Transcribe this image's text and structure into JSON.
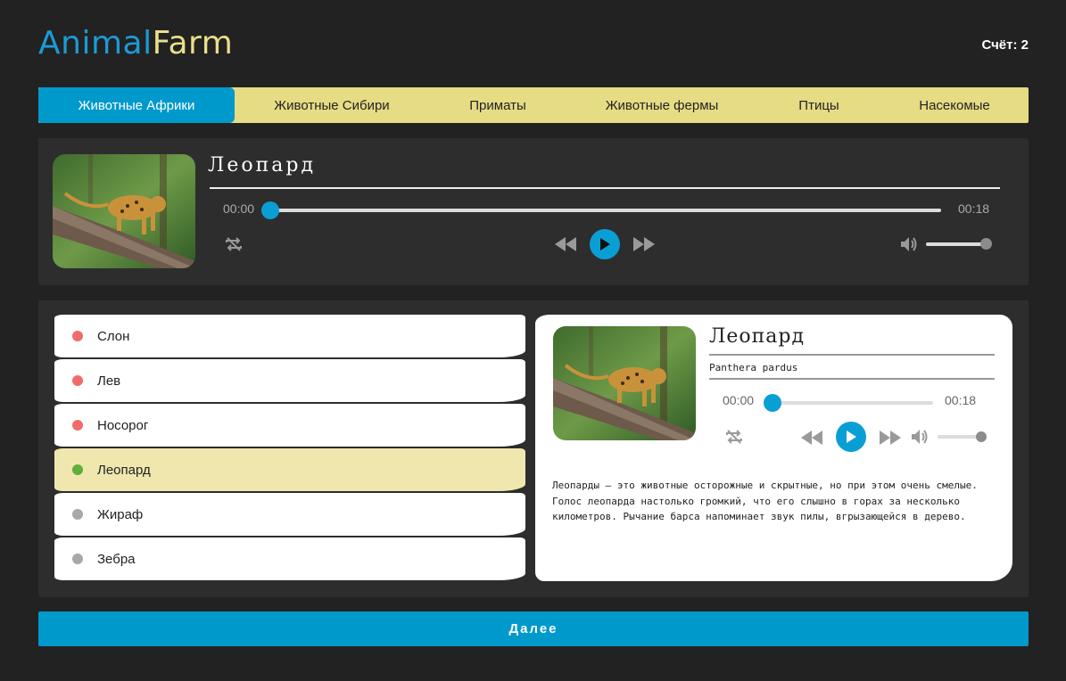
{
  "header": {
    "logo_part1": "Animal",
    "logo_part2": "Farm",
    "score": "Счёт: 2"
  },
  "nav": {
    "tabs": [
      {
        "label": "Животные Африки",
        "active": true
      },
      {
        "label": "Животные Сибири",
        "active": false
      },
      {
        "label": "Приматы",
        "active": false
      },
      {
        "label": "Животные фермы",
        "active": false
      },
      {
        "label": "Птицы",
        "active": false
      },
      {
        "label": "Насекомые",
        "active": false
      }
    ]
  },
  "player": {
    "title": "Леопард",
    "current_time": "00:00",
    "duration": "00:18",
    "progress": 0,
    "volume": 1
  },
  "animals": [
    {
      "label": "Слон",
      "status_color": "#f26b6b"
    },
    {
      "label": "Лев",
      "status_color": "#f26b6b"
    },
    {
      "label": "Носорог",
      "status_color": "#f26b6b"
    },
    {
      "label": "Леопард",
      "status_color": "#5fae3a",
      "active": true
    },
    {
      "label": "Жираф",
      "status_color": "#a8a8a8"
    },
    {
      "label": "Зебра",
      "status_color": "#a8a8a8"
    }
  ],
  "detail": {
    "title": "Леопард",
    "latin": "Panthera pardus",
    "current_time": "00:00",
    "duration": "00:18",
    "description": "Леопарды — это животные осторожные и скрытные, но при этом очень смелые. Голос леопарда настолько громкий, что его слышно в горах за несколько километров. Рычание барса напоминает звук пилы, вгрызающейся в дерево."
  },
  "next_button": "Далее",
  "colors": {
    "accent": "#0099cc",
    "nav_bg": "#e6dc84",
    "active_row": "#efe7ae",
    "background": "#222222",
    "panel": "#2d2d2d"
  },
  "icons": [
    "repeat-icon",
    "rewind-icon",
    "play-icon",
    "fast-forward-icon",
    "volume-icon",
    "leopard-photo"
  ]
}
